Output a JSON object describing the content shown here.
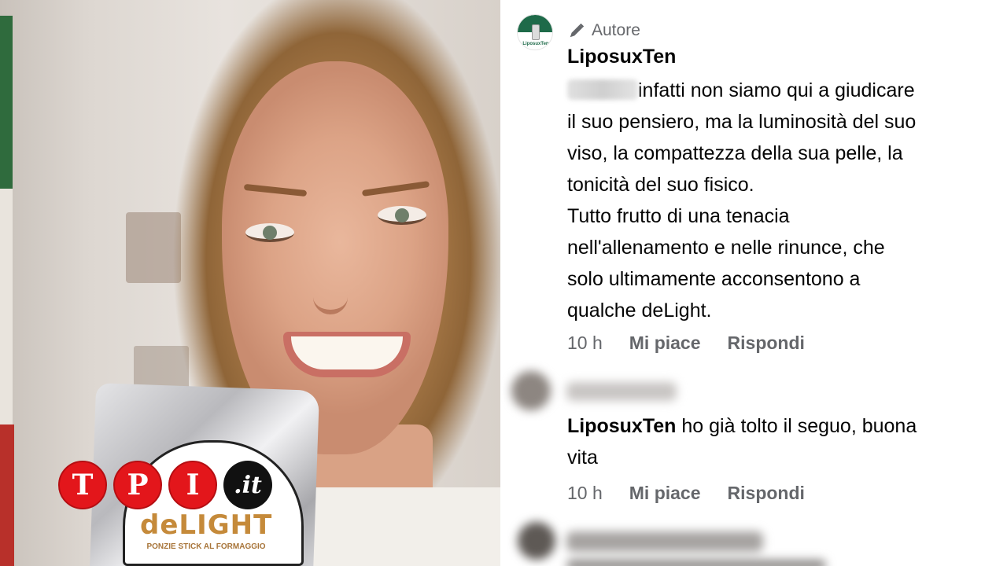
{
  "photo": {
    "bag_brand": "deLIGHT",
    "bag_subtitle": "PONZIE STICK AL FORMAGGIO",
    "logo": {
      "letters": [
        "T",
        "P",
        "I"
      ],
      "suffix": ".it",
      "red": "#e3161b",
      "dark": "#111111"
    }
  },
  "comment": {
    "author_tag": "Autore",
    "author_tag_icon": "pencil-icon",
    "author": "LiposuxTen",
    "text_lines": [
      "infatti non siamo qui a giudicare",
      "il suo pensiero, ma la luminosità del suo",
      "viso, la compattezza della sua pelle, la",
      "tonicità del suo fisico.",
      "Tutto frutto di una tenacia",
      "nell'allenamento e nelle rinunce, che",
      "solo ultimamente acconsentono a",
      "qualche deLight."
    ],
    "time": "10 h",
    "like_label": "Mi piace",
    "reply_label": "Rispondi"
  },
  "reply": {
    "author": "LiposuxTen",
    "text_line1": "ho già tolto il seguo, buona",
    "text_line2": "vita",
    "time": "10 h",
    "like_label": "Mi piace",
    "reply_label": "Rispondi"
  },
  "colors": {
    "brand_green": "#1e6a49",
    "meta_gray": "#65676b",
    "text_black": "#050505"
  }
}
